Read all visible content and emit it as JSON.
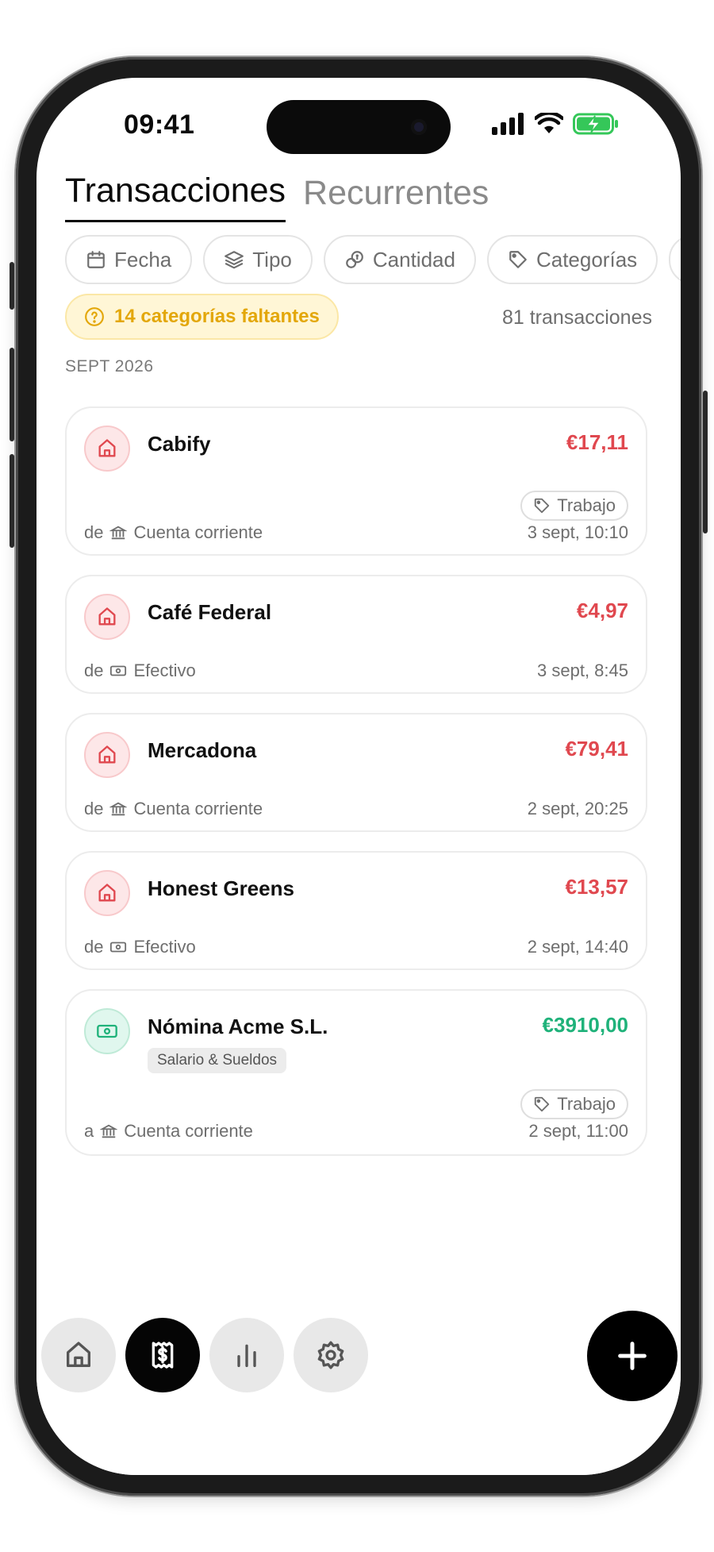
{
  "status_bar": {
    "time": "09:41"
  },
  "tabs": [
    {
      "label": "Transacciones",
      "active": true
    },
    {
      "label": "Recurrentes",
      "active": false
    }
  ],
  "filters": [
    {
      "label": "Fecha",
      "icon": "calendar-icon"
    },
    {
      "label": "Tipo",
      "icon": "layers-icon"
    },
    {
      "label": "Cantidad",
      "icon": "coins-icon"
    },
    {
      "label": "Categorías",
      "icon": "tag-icon"
    }
  ],
  "summary": {
    "missing_categories": "14 categorías faltantes",
    "transaction_count": "81 transacciones"
  },
  "month_header": "SEPT 2026",
  "transactions": [
    {
      "merchant": "Cabify",
      "amount": "€17,11",
      "type": "expense",
      "tag": "Trabajo",
      "direction": "de",
      "account": "Cuenta corriente",
      "account_icon": "bank-icon",
      "date": "3 sept, 10:10"
    },
    {
      "merchant": "Café Federal",
      "amount": "€4,97",
      "type": "expense",
      "direction": "de",
      "account": "Efectivo",
      "account_icon": "cash-icon",
      "date": "3 sept, 8:45"
    },
    {
      "merchant": "Mercadona",
      "amount": "€79,41",
      "type": "expense",
      "direction": "de",
      "account": "Cuenta corriente",
      "account_icon": "bank-icon",
      "date": "2 sept, 20:25"
    },
    {
      "merchant": "Honest Greens",
      "amount": "€13,57",
      "type": "expense",
      "direction": "de",
      "account": "Efectivo",
      "account_icon": "cash-icon",
      "date": "2 sept, 14:40"
    },
    {
      "merchant": "Nómina Acme S.L.",
      "amount": "€3910,00",
      "type": "income",
      "category": "Salario & Sueldos",
      "tag": "Trabajo",
      "direction": "a",
      "account": "Cuenta corriente",
      "account_icon": "bank-icon",
      "date": "2 sept, 11:00"
    }
  ],
  "nav": [
    {
      "name": "home",
      "icon": "home-icon",
      "active": false
    },
    {
      "name": "transactions",
      "icon": "receipt-dollar-icon",
      "active": true
    },
    {
      "name": "stats",
      "icon": "bar-chart-icon",
      "active": false
    },
    {
      "name": "settings",
      "icon": "gear-icon",
      "active": false
    }
  ],
  "colors": {
    "expense": "#e0484f",
    "income": "#1fb27a",
    "warning": "#e3a70a"
  }
}
